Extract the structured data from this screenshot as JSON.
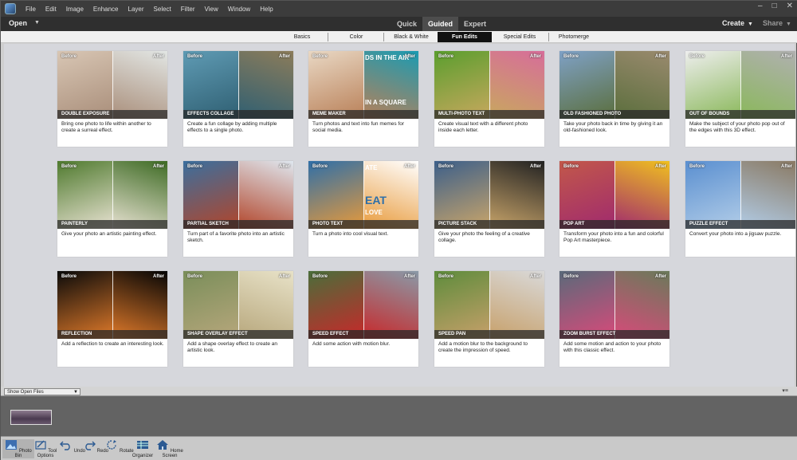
{
  "menubar": {
    "items": [
      "File",
      "Edit",
      "Image",
      "Enhance",
      "Layer",
      "Select",
      "Filter",
      "View",
      "Window",
      "Help"
    ],
    "controls": [
      "–",
      "□",
      "✕"
    ]
  },
  "header": {
    "open_label": "Open",
    "modes": [
      "Quick",
      "Guided",
      "Expert"
    ],
    "active_mode": "Guided",
    "create_label": "Create",
    "share_label": "Share"
  },
  "subtabs": {
    "items": [
      "Basics",
      "Color",
      "Black & White",
      "Fun Edits",
      "Special Edits",
      "Photomerge"
    ],
    "active": "Fun Edits"
  },
  "labels": {
    "before": "Before",
    "after": "After"
  },
  "cards": [
    {
      "title": "DOUBLE EXPOSURE",
      "desc": "Bring one photo to life within another to create a surreal effect.",
      "c1": "#d8c6b4",
      "c2": "#a98e7a",
      "c3": "#e2e6e4"
    },
    {
      "title": "EFFECTS COLLAGE",
      "desc": "Create a fun collage by adding multiple effects to a single photo.",
      "c1": "#5f9bb4",
      "c2": "#2f5f72",
      "c3": "#8c7c5a"
    },
    {
      "title": "MEME MAKER",
      "desc": "Turn photos and text into fun memes for social media.",
      "c1": "#e9d8c4",
      "c2": "#b98058",
      "c3": "#1b9bb2",
      "text1": "DS IN THE AIR",
      "text2": "IN A SQUARE"
    },
    {
      "title": "MULTI-PHOTO TEXT",
      "desc": "Create visual text with a different photo inside each letter.",
      "c1": "#5a9e2e",
      "c2": "#c8a85e",
      "c3": "#d76d9a"
    },
    {
      "title": "OLD FASHIONED PHOTO",
      "desc": "Take your photo back in time by giving it an old-fashioned look.",
      "c1": "#7fa1c6",
      "c2": "#5a6e3c",
      "c3": "#9a8a6e"
    },
    {
      "title": "OUT OF BOUNDS",
      "desc": "Make the subject of your photo pop out of the edges with this 3D effect.",
      "c1": "#eeeeee",
      "c2": "#8ab85a",
      "c3": "#b0b0b0"
    },
    {
      "title": "PAINTERLY",
      "desc": "Give your photo an artistic painting effect.",
      "c1": "#4f7a2e",
      "c2": "#e8e2d2",
      "c3": "#3e6b24"
    },
    {
      "title": "PARTIAL SKETCH",
      "desc": "Turn part of a favorite photo into an artistic sketch.",
      "c1": "#3b6f9e",
      "c2": "#b2452a",
      "c3": "#dfe7ef"
    },
    {
      "title": "PHOTO TEXT",
      "desc": "Turn a photo into cool visual text.",
      "c1": "#2f6fa8",
      "c2": "#e89a3a",
      "c3": "#ffffff",
      "text1": "ATE",
      "text2": "LOVE",
      "text3": "EAT"
    },
    {
      "title": "PICTURE STACK",
      "desc": "Give your photo the feeling of a creative collage.",
      "c1": "#3c5f8a",
      "c2": "#c9a56a",
      "c3": "#222222"
    },
    {
      "title": "POP ART",
      "desc": "Transform your photo into a fun and colorful Pop Art masterpiece.",
      "c1": "#c2584a",
      "c2": "#a02a6e",
      "c3": "#f0c020"
    },
    {
      "title": "PUZZLE EFFECT",
      "desc": "Convert your photo into a jigsaw puzzle.",
      "c1": "#5a8fd0",
      "c2": "#b2cde8",
      "c3": "#8a7a64"
    },
    {
      "title": "REFLECTION",
      "desc": "Add a reflection to create an interesting look.",
      "c1": "#0a0a0a",
      "c2": "#e07a2a",
      "c3": "#050505"
    },
    {
      "title": "SHAPE OVERLAY EFFECT",
      "desc": "Add a shape overlay effect to create an artistic look.",
      "c1": "#7a8e5a",
      "c2": "#b7a77c",
      "c3": "#e8e2c8"
    },
    {
      "title": "SPEED EFFECT",
      "desc": "Add some action with motion blur.",
      "c1": "#4a6e3a",
      "c2": "#c8282a",
      "c3": "#8a9aa8"
    },
    {
      "title": "SPEED PAN",
      "desc": "Add a motion blur to the background to create the impression of speed.",
      "c1": "#5e8c3c",
      "c2": "#c7a06a",
      "c3": "#d9d9d9"
    },
    {
      "title": "ZOOM BURST EFFECT",
      "desc": "Add some motion and action to your photo with this classic effect.",
      "c1": "#5a6a7a",
      "c2": "#d84a7a",
      "c3": "#6a7a5a"
    }
  ],
  "bin": {
    "select_label": "Show Open Files"
  },
  "taskbar": {
    "items": [
      "Photo Bin",
      "Tool Options",
      "Undo",
      "Redo",
      "Rotate",
      "Organizer",
      "Home Screen"
    ]
  }
}
